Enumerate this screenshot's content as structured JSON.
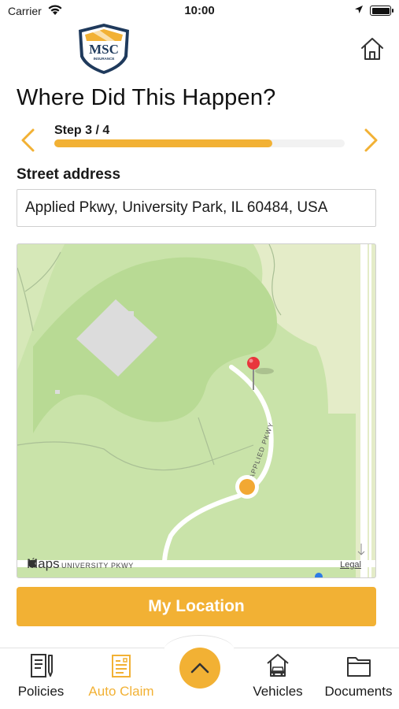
{
  "status_bar": {
    "carrier": "Carrier",
    "time": "10:00"
  },
  "header": {
    "logo_text": "MSC",
    "logo_subtext": "INSURANCE"
  },
  "page": {
    "title": "Where Did This Happen?"
  },
  "step": {
    "label": "Step 3 / 4",
    "progress": 0.75
  },
  "form": {
    "address_label": "Street address",
    "address_value": "Applied Pkwy, University Park, IL 60484, USA"
  },
  "map": {
    "attribution": "Maps",
    "legal": "Legal",
    "road_label_1": "APPLIED PKWY",
    "road_label_2": "UNIVERSITY PKWY"
  },
  "actions": {
    "my_location": "My Location"
  },
  "nav": {
    "items": [
      {
        "label": "Policies",
        "icon": "document-pen-icon"
      },
      {
        "label": "Auto Claim",
        "icon": "clipboard-icon",
        "active": true
      },
      {
        "label": "Vehicles",
        "icon": "car-house-icon"
      },
      {
        "label": "Documents",
        "icon": "folder-icon"
      }
    ]
  },
  "colors": {
    "accent": "#f2b134",
    "map_green": "#c9e3a9",
    "pin_red": "#e8353c",
    "location_dot": "#f2a833"
  }
}
